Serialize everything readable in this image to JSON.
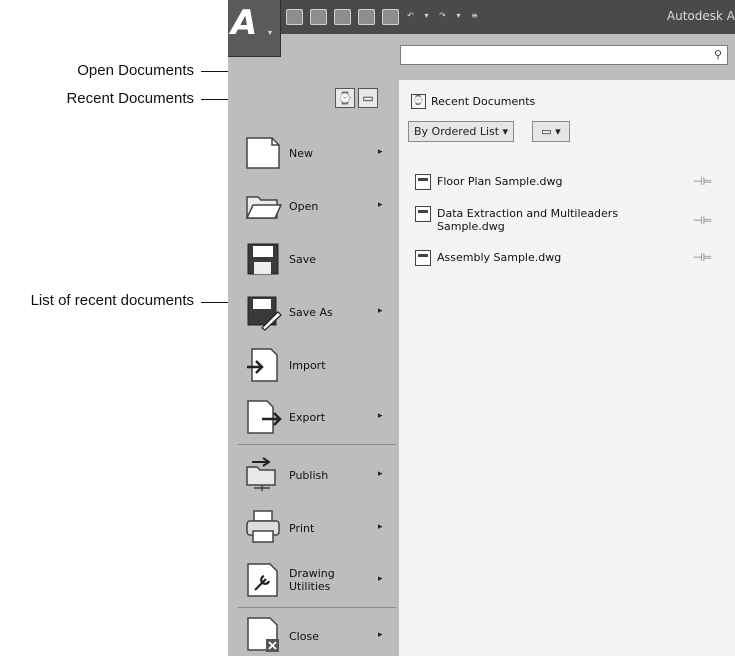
{
  "callouts": {
    "open_documents": "Open Documents",
    "recent_documents": "Recent Documents",
    "list_of_recent": "List of recent documents"
  },
  "titlebar": {
    "title": "Autodesk A"
  },
  "app_button": {
    "glyph": "A",
    "caret": "▾"
  },
  "qat": {
    "icons": [
      "new-icon",
      "open-icon",
      "save-icon",
      "saveas-icon",
      "plot-icon",
      "undo-icon",
      "redo-icon",
      "customize-icon"
    ]
  },
  "search": {
    "value": "",
    "placeholder": "",
    "icon": "search-icon"
  },
  "toggles": [
    {
      "name": "recent-documents-toggle",
      "icon": "recent-docs-icon",
      "glyph": "⌚"
    },
    {
      "name": "open-documents-toggle",
      "icon": "open-docs-icon",
      "glyph": "▭"
    }
  ],
  "menu": {
    "items": [
      {
        "label": "New",
        "arrow": "▸"
      },
      {
        "label": "Open",
        "arrow": "▸"
      },
      {
        "label": "Save",
        "arrow": ""
      },
      {
        "label": "Save As",
        "arrow": "▸"
      },
      {
        "label": "Import",
        "arrow": ""
      },
      {
        "label": "Export",
        "arrow": "▸"
      },
      {
        "label": "Publish",
        "arrow": "▸"
      },
      {
        "label": "Print",
        "arrow": "▸"
      },
      {
        "label": "Drawing\nUtilities",
        "arrow": "▸"
      },
      {
        "label": "Close",
        "arrow": "▸"
      }
    ]
  },
  "panel": {
    "title": "Recent Documents",
    "sort_label": "By Ordered List ▾",
    "view_label": "▭ ▾",
    "documents": [
      {
        "name": "Floor Plan Sample.dwg",
        "pin": "⊣⊨"
      },
      {
        "name": "Data Extraction and Multileaders Sample.dwg",
        "pin": "⊣⊨"
      },
      {
        "name": "Assembly Sample.dwg",
        "pin": "⊣⊨"
      }
    ]
  },
  "colors": {
    "titlebar": "#4a4a4a",
    "menu_bg": "#bdbdbd",
    "panel_bg": "#f4f4f4"
  }
}
